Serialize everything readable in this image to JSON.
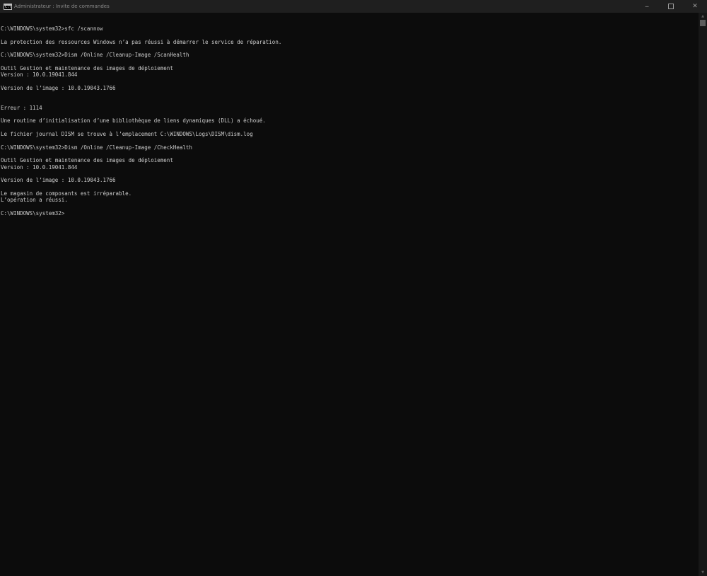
{
  "window": {
    "title": "Administrateur : Invite de commandes",
    "icon": "cmd-icon",
    "icon_glyph": "C:\\",
    "controls": {
      "minimize": "─",
      "close": "✕"
    }
  },
  "console": {
    "lines": [
      "",
      "C:\\WINDOWS\\system32>sfc /scannow",
      "",
      "La protection des ressources Windows n’a pas réussi à démarrer le service de réparation.",
      "",
      "C:\\WINDOWS\\system32>Dism /Online /Cleanup-Image /ScanHealth",
      "",
      "Outil Gestion et maintenance des images de déploiement",
      "Version : 10.0.19041.844",
      "",
      "Version de l’image : 10.0.19043.1766",
      "",
      "",
      "Erreur : 1114",
      "",
      "Une routine d’initialisation d’une bibliothèque de liens dynamiques (DLL) a échoué.",
      "",
      "Le fichier journal DISM se trouve à l’emplacement C:\\WINDOWS\\Logs\\DISM\\dism.log",
      "",
      "C:\\WINDOWS\\system32>Dism /Online /Cleanup-Image /CheckHealth",
      "",
      "Outil Gestion et maintenance des images de déploiement",
      "Version : 10.0.19041.844",
      "",
      "Version de l’image : 10.0.19043.1766",
      "",
      "Le magasin de composants est irréparable.",
      "L’opération a réussi.",
      "",
      "C:\\WINDOWS\\system32>"
    ]
  },
  "scrollbar": {
    "up_arrow": "▲",
    "down_arrow": "▼"
  },
  "colors": {
    "background": "#0c0c0c",
    "text": "#cccccc",
    "titlebar": "#1f1f1f"
  }
}
